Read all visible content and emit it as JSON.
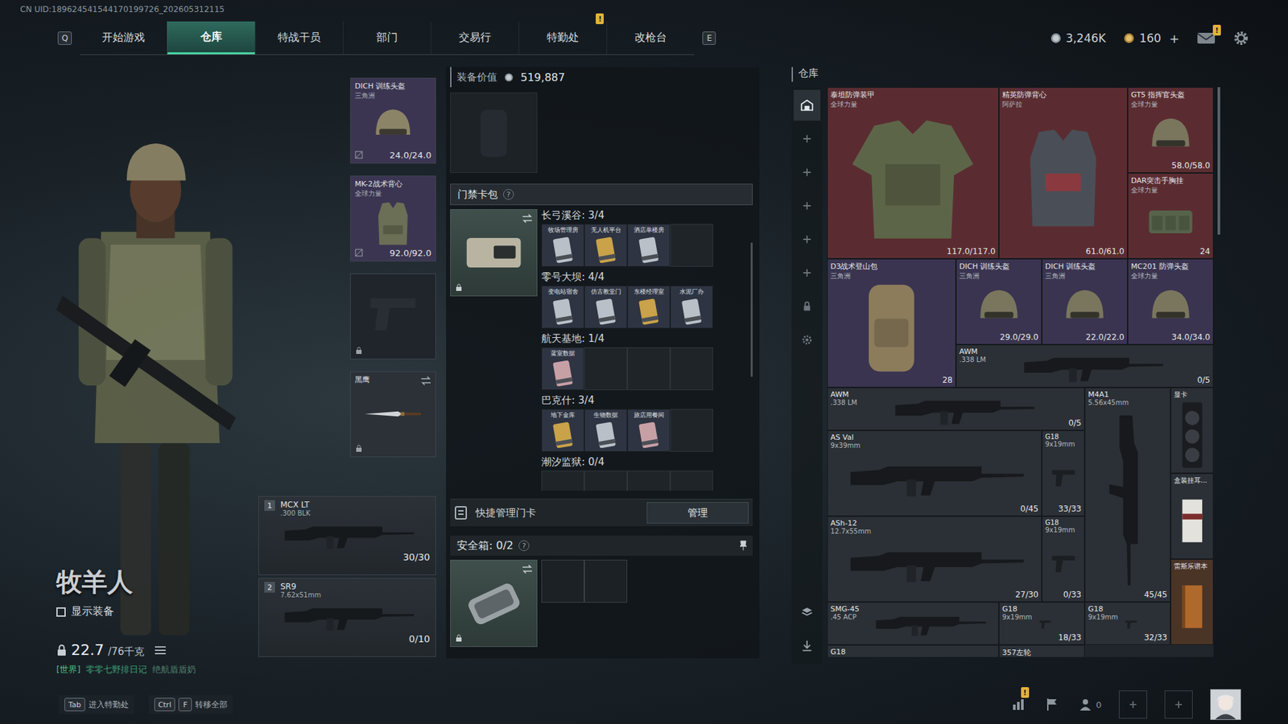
{
  "uid": "CN UID:189624541544170199726_202605312115",
  "nav": {
    "prev_key": "Q",
    "next_key": "E",
    "tabs": [
      {
        "label": "开始游戏",
        "selected": false
      },
      {
        "label": "仓库",
        "selected": true
      },
      {
        "label": "特战干员",
        "selected": false
      },
      {
        "label": "部门",
        "selected": false
      },
      {
        "label": "交易行",
        "selected": false
      },
      {
        "label": "特勤处",
        "selected": false,
        "badge": "!"
      },
      {
        "label": "改枪台",
        "selected": false
      }
    ]
  },
  "currency": {
    "coins": "3,246K",
    "tickets": "160",
    "add": "+",
    "mail_badge": "!"
  },
  "operator": {
    "name": "牧羊人",
    "show_gear": {
      "label": "显示装备",
      "checked": false
    },
    "weight": "22.7",
    "weight_max": "/76千克"
  },
  "chat": {
    "channel": "[世界]",
    "sender": "零零七野排日记",
    "message": "绝航盾盾奶"
  },
  "gear_slots": [
    {
      "kind": "helmet",
      "empty": false,
      "name": "DICH 训练头盔",
      "brand": "三角洲",
      "durability": "24.0/24.0",
      "color": "#3b3552"
    },
    {
      "kind": "armor",
      "empty": false,
      "name": "MK-2战术背心",
      "brand": "全球力量",
      "durability": "92.0/92.0",
      "color": "#3b3552"
    },
    {
      "kind": "pistol",
      "empty": true,
      "color": "#1f252a"
    },
    {
      "kind": "knife",
      "empty": false,
      "name": "黑鹰",
      "color": "#2b3137"
    }
  ],
  "weapons": [
    {
      "slot": "1",
      "name": "MCX LT",
      "caliber": ".300 BLK",
      "ammo": "30/30"
    },
    {
      "slot": "2",
      "name": "SR9",
      "caliber": "7.62x51mm",
      "ammo": "0/10"
    }
  ],
  "loadout_value": {
    "label": "装备价值",
    "value": "519,887"
  },
  "keycard_pack": {
    "title": "门禁卡包",
    "help": "?",
    "groups": [
      {
        "title": "长弓溪谷: 3/4",
        "capacity": 4,
        "cards": [
          {
            "name": "牧场管理房",
            "color": "#b9c0c8"
          },
          {
            "name": "无人机平台",
            "color": "#c9a24a"
          },
          {
            "name": "酒店单楼房",
            "color": "#b9c0c8"
          }
        ]
      },
      {
        "title": "零号大坝: 4/4",
        "capacity": 4,
        "cards": [
          {
            "name": "变电站宿舍",
            "color": "#b9c0c8"
          },
          {
            "name": "仿古教堂门",
            "color": "#b9c0c8"
          },
          {
            "name": "东楼经理室",
            "color": "#c9a24a"
          },
          {
            "name": "水泥厂办",
            "color": "#b9c0c8"
          }
        ]
      },
      {
        "title": "航天基地: 1/4",
        "capacity": 4,
        "cards": [
          {
            "name": "蓝室数据",
            "color": "#c7a0a6"
          }
        ]
      },
      {
        "title": "巴克什: 3/4",
        "capacity": 4,
        "cards": [
          {
            "name": "地下金库",
            "color": "#c9a24a"
          },
          {
            "name": "生物数据",
            "color": "#b9c0c8"
          },
          {
            "name": "旅店用餐间",
            "color": "#c7a0a6"
          }
        ]
      },
      {
        "title": "潮汐监狱: 0/4",
        "capacity": 4,
        "cards": []
      }
    ]
  },
  "quick_manage": {
    "label": "快捷管理门卡",
    "button": "管理"
  },
  "safe_box": {
    "title": "安全箱: 0/2",
    "help": "?",
    "capacity": 2
  },
  "warehouse": {
    "title": "仓库",
    "items": [
      {
        "name": "泰坦防弹装甲",
        "sub": "全球力量",
        "stat": "117.0/117.0",
        "kind": "armor",
        "color": "#5a2c31"
      },
      {
        "name": "精英防弹背心",
        "sub": "阿萨拉",
        "stat": "61.0/61.0",
        "kind": "vest",
        "color": "#5a2c31"
      },
      {
        "name": "GT5 指挥官头盔",
        "sub": "全球力量",
        "stat": "58.0/58.0",
        "kind": "helmet",
        "color": "#5a2c31"
      },
      {
        "name": "DAR突击手胸挂",
        "sub": "全球力量",
        "stat": "24",
        "kind": "rig",
        "color": "#5a2c31"
      },
      {
        "name": "D3战术登山包",
        "sub": "三角洲",
        "stat": "28",
        "kind": "backpack",
        "color": "#3a3450"
      },
      {
        "name": "DICH 训练头盔",
        "sub": "三角洲",
        "stat": "29.0/29.0",
        "kind": "helmet",
        "color": "#3a3450"
      },
      {
        "name": "DICH 训练头盔",
        "sub": "三角洲",
        "stat": "22.0/22.0",
        "kind": "helmet",
        "color": "#3a3450"
      },
      {
        "name": "MC201 防弹头盔",
        "sub": "全球力量",
        "stat": "34.0/34.0",
        "kind": "helmet",
        "color": "#3a3450"
      },
      {
        "name": "AWM",
        "sub": ".338 LM",
        "stat": "0/5",
        "kind": "rifle",
        "color": "#2b3036"
      },
      {
        "name": "AWM",
        "sub": ".338 LM",
        "stat": "0/5",
        "kind": "rifle",
        "color": "#2b3036"
      },
      {
        "name": "M4A1",
        "sub": "5.56x45mm",
        "stat": "45/45",
        "kind": "rifle-vertical",
        "color": "#2b3036"
      },
      {
        "name": "显卡",
        "kind": "gpu",
        "color": "#2b3036"
      },
      {
        "name": "AS Val",
        "sub": "9x39mm",
        "stat": "0/45",
        "kind": "rifle",
        "color": "#2b3036"
      },
      {
        "name": "G18",
        "sub": "9x19mm",
        "stat": "33/33",
        "kind": "pistol",
        "color": "#2b3036"
      },
      {
        "name": "盒装挂耳...",
        "kind": "box",
        "color": "#2b3036"
      },
      {
        "name": "ASh-12",
        "sub": "12.7x55mm",
        "stat": "27/30",
        "kind": "rifle",
        "color": "#2b3036"
      },
      {
        "name": "G18",
        "sub": "9x19mm",
        "stat": "0/33",
        "kind": "pistol",
        "color": "#2b3036"
      },
      {
        "name": "雷斯乐谱本",
        "kind": "book",
        "color": "#4a3426"
      },
      {
        "name": "SMG-45",
        "sub": ".45 ACP",
        "kind": "rifle",
        "color": "#2b3036"
      },
      {
        "name": "G18",
        "sub": "9x19mm",
        "stat": "18/33",
        "kind": "pistol",
        "color": "#2b3036"
      },
      {
        "name": "G18",
        "sub": "9x19mm",
        "stat": "32/33",
        "kind": "pistol",
        "color": "#2b3036"
      },
      {
        "name": "G18",
        "kind": "rifle",
        "color": "#2b3036"
      },
      {
        "name": "357左轮",
        "kind": "pistol",
        "color": "#2b3036"
      }
    ]
  },
  "footer": {
    "hints": [
      {
        "keys": [
          "Tab"
        ],
        "label": "进入特勤处"
      },
      {
        "keys": [
          "Ctrl",
          "F"
        ],
        "label": "转移全部"
      }
    ],
    "stats_badge": "!",
    "squad_count": "0"
  }
}
